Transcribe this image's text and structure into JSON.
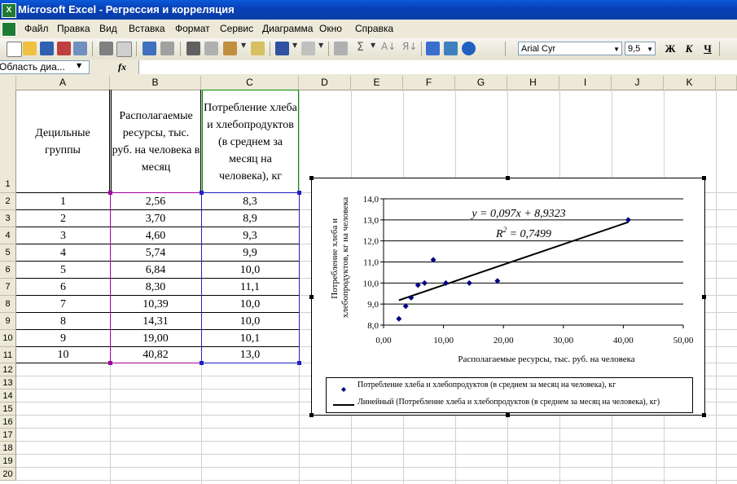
{
  "window": {
    "title": "Microsoft Excel - Регрессия и корреляция"
  },
  "menu": [
    "Файл",
    "Правка",
    "Вид",
    "Вставка",
    "Формат",
    "Сервис",
    "Диаграмма",
    "Окно",
    "Справка"
  ],
  "toolbar": {
    "font_name": "Arial Cyr",
    "font_size": "9,5",
    "bold": "Ж",
    "italic": "К",
    "underline": "Ч"
  },
  "formula_bar": {
    "name_box": "Область диа...",
    "fx": "fx",
    "value": ""
  },
  "columns": [
    "A",
    "B",
    "C",
    "D",
    "E",
    "F",
    "G",
    "H",
    "I",
    "J",
    "K"
  ],
  "rows": [
    "1",
    "2",
    "3",
    "4",
    "5",
    "6",
    "7",
    "8",
    "9",
    "10",
    "11",
    "12",
    "13",
    "14",
    "15",
    "16",
    "17",
    "18",
    "19",
    "20"
  ],
  "table": {
    "headers": [
      "Децильные группы",
      "Располагаемые ресурсы, тыс. руб. на человека в месяц",
      "Потребление хлеба и хлебопродуктов (в среднем за месяц на человека), кг"
    ],
    "rows": [
      [
        "1",
        "2,56",
        "8,3"
      ],
      [
        "2",
        "3,70",
        "8,9"
      ],
      [
        "3",
        "4,60",
        "9,3"
      ],
      [
        "4",
        "5,74",
        "9,9"
      ],
      [
        "5",
        "6,84",
        "10,0"
      ],
      [
        "6",
        "8,30",
        "11,1"
      ],
      [
        "7",
        "10,39",
        "10,0"
      ],
      [
        "8",
        "14,31",
        "10,0"
      ],
      [
        "9",
        "19,00",
        "10,1"
      ],
      [
        "10",
        "40,82",
        "13,0"
      ]
    ]
  },
  "chart_data": {
    "type": "scatter",
    "series": [
      {
        "name": "Потребление хлеба и хлебопродуктов (в среднем за месяц на человека), кг",
        "x": [
          2.56,
          3.7,
          4.6,
          5.74,
          6.84,
          8.3,
          10.39,
          14.31,
          19.0,
          40.82
        ],
        "y": [
          8.3,
          8.9,
          9.3,
          9.9,
          10.0,
          11.1,
          10.0,
          10.0,
          10.1,
          13.0
        ],
        "color": "#000080"
      }
    ],
    "trendline": {
      "name": "Линейный (Потребление хлеба и хлебопродуктов (в среднем за месяц на человека), кг)",
      "slope": 0.097,
      "intercept": 8.9323
    },
    "equation": "y = 0,097x + 8,9323",
    "r2_label": "R",
    "r2_sup": "2",
    "r2_value": " = 0,7499",
    "xlabel": "Располагаемые ресурсы, тыс. руб. на человека",
    "ylabel": "Потребление хлеба и хлебопродуктов, кг на человека",
    "xlim": [
      0,
      50
    ],
    "ylim": [
      8,
      14
    ],
    "xticks": [
      "0,00",
      "10,00",
      "20,00",
      "30,00",
      "40,00",
      "50,00"
    ],
    "yticks": [
      "8,0",
      "9,0",
      "10,0",
      "11,0",
      "12,0",
      "13,0",
      "14,0"
    ],
    "grid": "horizontal",
    "legend_position": "bottom"
  }
}
